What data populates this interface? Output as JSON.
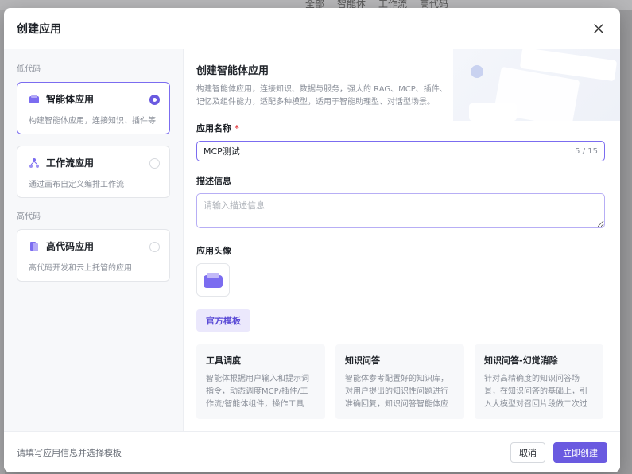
{
  "background": {
    "tabs": [
      "全部",
      "智能体",
      "工作流",
      "高代码"
    ]
  },
  "modal": {
    "title": "创建应用",
    "close_icon": "close-icon"
  },
  "sidebar": {
    "low_code_label": "低代码",
    "high_code_label": "高代码",
    "types": [
      {
        "name": "智能体应用",
        "desc": "构建智能体应用，连接知识、插件等",
        "icon": "agent-icon",
        "selected": true
      },
      {
        "name": "工作流应用",
        "desc": "通过画布自定义编排工作流",
        "icon": "workflow-icon",
        "selected": false
      },
      {
        "name": "高代码应用",
        "desc": "高代码开发和云上托管的应用",
        "icon": "code-icon",
        "selected": false
      }
    ]
  },
  "main": {
    "title": "创建智能体应用",
    "desc": "构建智能体应用，连接知识、数据与服务，强大的 RAG、MCP、插件、记忆及组件能力，适配多种模型，适用于智能助理型、对话型场景。",
    "name_label": "应用名称",
    "required_mark": "*",
    "name_value": "MCP测试",
    "name_count": "5 / 15",
    "desc_label": "描述信息",
    "desc_placeholder": "请输入描述信息",
    "avatar_label": "应用头像",
    "template_tab": "官方模板",
    "templates": [
      {
        "title": "工具调度",
        "desc": "智能体根据用户输入和提示词指令，动态调度MCP/插件/工作流/智能体组件，操作工具完..."
      },
      {
        "title": "知识问答",
        "desc": "智能体参考配置好的知识库，对用户提出的知识性问题进行准确回复，知识问答智能体应用已..."
      },
      {
        "title": "知识问答-幻觉消除",
        "desc": "针对高精确度的知识问答场景，在知识问答的基础上，引入大模型对召回片段做二次过滤，并..."
      }
    ]
  },
  "footer": {
    "hint": "请填写应用信息并选择模板",
    "cancel": "取消",
    "create": "立即创建"
  },
  "colors": {
    "accent": "#6a5ae0",
    "accent_light": "#ebe8fc"
  }
}
